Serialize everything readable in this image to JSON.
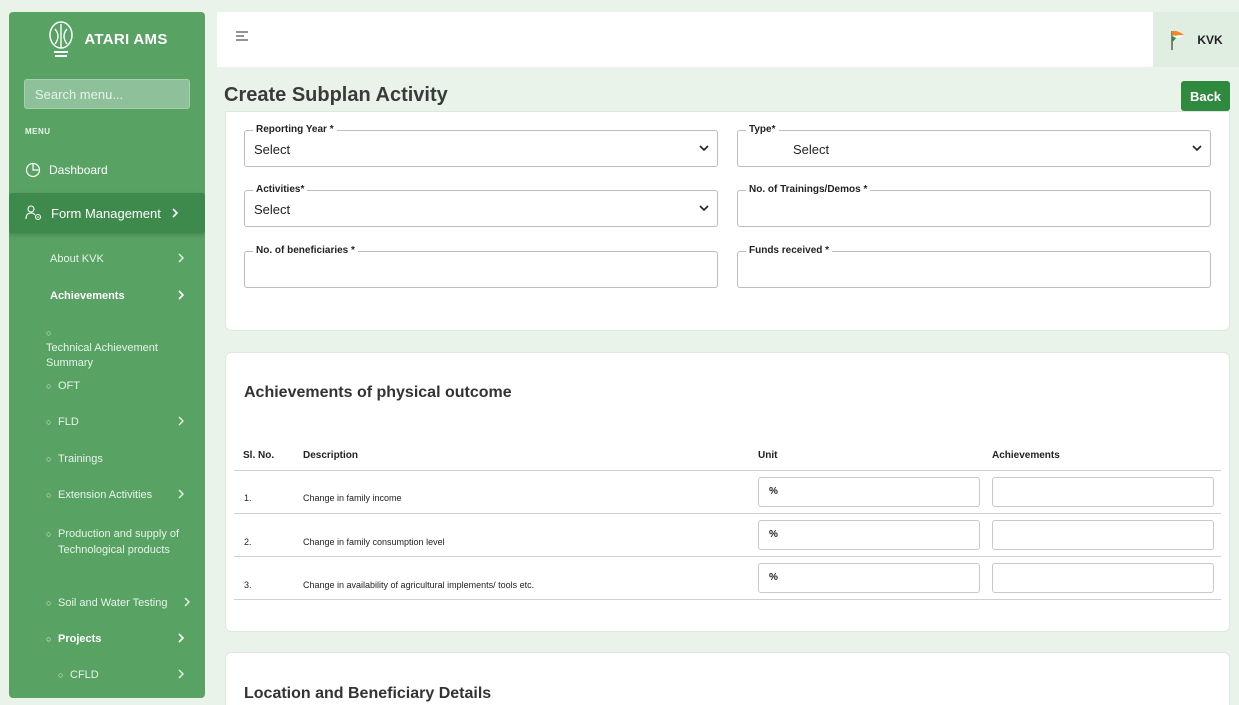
{
  "brand": {
    "name": "ATARI AMS"
  },
  "sidebar": {
    "search_placeholder": "Search menu...",
    "menu_heading": "MENU",
    "dashboard": "Dashboard",
    "form_management": "Form Management",
    "items": [
      {
        "label": "About KVK"
      },
      {
        "label": "Achievements"
      },
      {
        "label": "Technical Achievement Summary"
      },
      {
        "label": "OFT"
      },
      {
        "label": "FLD"
      },
      {
        "label": "Trainings"
      },
      {
        "label": "Extension Activities"
      },
      {
        "label": "Production and supply of Technological products"
      },
      {
        "label": "Soil and Water Testing"
      },
      {
        "label": "Projects"
      },
      {
        "label": "CFLD"
      }
    ]
  },
  "topbar": {
    "user_label": "KVK"
  },
  "page": {
    "title": "Create Subplan Activity",
    "back_label": "Back"
  },
  "form": {
    "reporting_year": {
      "label": "Reporting Year *",
      "value": "Select"
    },
    "type": {
      "label": "Type*",
      "value": "Select"
    },
    "activities": {
      "label": "Activities*",
      "value": "Select"
    },
    "trainings": {
      "label": "No. of Trainings/Demos *",
      "value": ""
    },
    "beneficiaries": {
      "label": "No. of beneficiaries *",
      "value": ""
    },
    "funds": {
      "label": "Funds received *",
      "value": ""
    }
  },
  "outcomes": {
    "title": "Achievements of physical outcome",
    "headers": {
      "sl": "Sl. No.",
      "description": "Description",
      "unit": "Unit",
      "achievements": "Achievements"
    },
    "rows": [
      {
        "sl": "1.",
        "description": "Change in family income",
        "unit": "%",
        "achievement": ""
      },
      {
        "sl": "2.",
        "description": "Change in family consumption level",
        "unit": "%",
        "achievement": ""
      },
      {
        "sl": "3.",
        "description": "Change in availability of agricultural implements/ tools etc.",
        "unit": "%",
        "achievement": ""
      }
    ]
  },
  "location": {
    "title": "Location and Beneficiary Details"
  },
  "colors": {
    "sidebar": "#58a264",
    "active": "#3e8a4c",
    "button": "#2f8a3f",
    "background": "#eaf3ea"
  },
  "icons": [
    "emblem-logo",
    "pie-chart-icon",
    "users-gear-icon",
    "hamburger-icon",
    "flag-icon",
    "chevron-right-icon",
    "chevron-down-icon"
  ]
}
